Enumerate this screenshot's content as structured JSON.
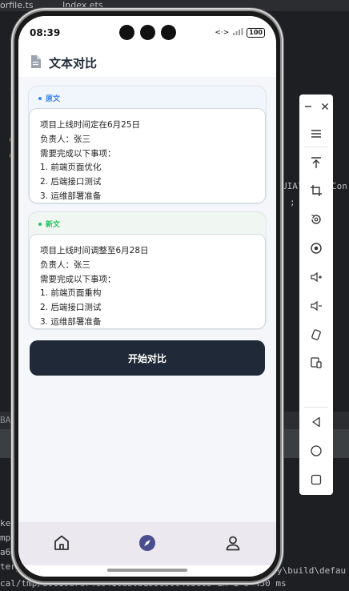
{
  "ide": {
    "tabs": [
      "orfile.ts",
      "Index.ets"
    ],
    "code_fragments": [
      "i",
      "i",
      "l",
      "c",
      "@",
      "@",
      "s",
      "UIAl",
      "Con",
      ";",
      "}",
      ")",
      "BAC"
    ],
    "terminal_lines": [
      "ket",
      "mpl",
      "a6c",
      "ter_",
      "cal/tmp/a6c10d7e74c6416ab0b159e90046b865 in 1 s 450 ms"
    ],
    "terminal_right": "y\\build\\defau"
  },
  "status": {
    "time": "08:39",
    "battery": "100"
  },
  "header": {
    "title": "文本对比",
    "icon": "document-icon"
  },
  "original": {
    "label": "原文",
    "accent": "#3b82f6",
    "lines": [
      "项目上线时间定在6月25日",
      "负责人：张三",
      "需要完成以下事项：",
      "1. 前端页面优化",
      "2. 后端接口测试",
      "3. 运维部署准备"
    ]
  },
  "revised": {
    "label": "新文",
    "accent": "#22c55e",
    "lines": [
      "项目上线时间调整至6月28日",
      "负责人：张三",
      "需要完成以下事项：",
      "1. 前端页面重构",
      "2. 后端接口测试",
      "3. 运维部署准备"
    ]
  },
  "actions": {
    "start_label": "开始对比"
  },
  "tabbar": {
    "items": [
      "home-icon",
      "compass-icon",
      "person-icon"
    ],
    "active": "compass-icon",
    "active_color": "#4a4e8f"
  },
  "toolbar": {
    "items": [
      "minimize-icon",
      "close-icon",
      "menu-icon",
      "pin-top-icon",
      "crop-icon",
      "rotate-icon",
      "screen-record-icon",
      "volume-up-icon",
      "volume-down-icon",
      "shake-icon",
      "multi-device-icon",
      "back-icon",
      "home-icon",
      "recent-apps-icon"
    ]
  }
}
